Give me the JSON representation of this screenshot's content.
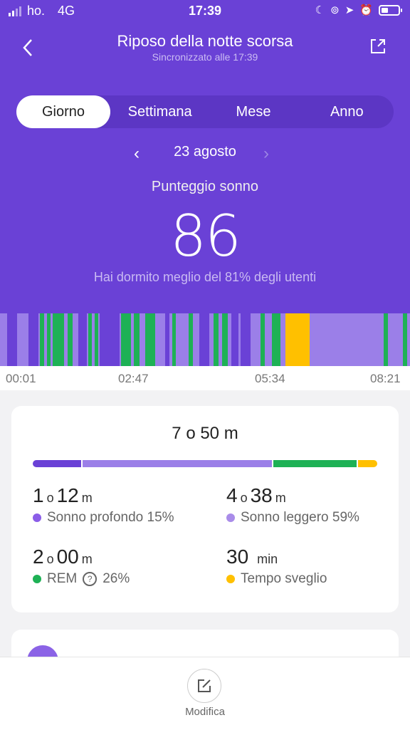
{
  "status_bar": {
    "carrier": "ho.",
    "network": "4G",
    "time": "17:39"
  },
  "header": {
    "title": "Riposo della notte scorsa",
    "subtitle": "Sincronizzato alle 17:39"
  },
  "tabs": [
    {
      "label": "Giorno",
      "active": true
    },
    {
      "label": "Settimana",
      "active": false
    },
    {
      "label": "Mese",
      "active": false
    },
    {
      "label": "Anno",
      "active": false
    }
  ],
  "date": "23 agosto",
  "score": {
    "label": "Punteggio sonno",
    "value": "86",
    "note": "Hai dormito meglio del 81% degli utenti"
  },
  "timeline": {
    "labels": [
      "00:01",
      "02:47",
      "05:34",
      "08:21"
    ],
    "colors": {
      "deep": "#6a41d6",
      "light": "#9b7fe8",
      "rem": "#1eb155",
      "awake": "#ffc000"
    }
  },
  "summary": {
    "total": "7 o 50 m",
    "distribution_pct": {
      "deep": 15,
      "light": 59,
      "rem": 26,
      "awake": 6
    },
    "stats": [
      {
        "num1": "1",
        "unit1": "o",
        "num2": "12",
        "unit2": "m",
        "label": "Sonno profondo 15%",
        "color": "#8b5de8"
      },
      {
        "num1": "4",
        "unit1": "o",
        "num2": "38",
        "unit2": "m",
        "label": "Sonno leggero 59%",
        "color": "#a98ce9"
      },
      {
        "num1": "2",
        "unit1": "o",
        "num2": "00",
        "unit2": "m",
        "label": "REM",
        "label_extra": "26%",
        "color": "#1eb155"
      },
      {
        "num1": "30",
        "unit1": "",
        "num2": "",
        "unit2": "min",
        "label": "Tempo sveglio",
        "color": "#ffc000"
      }
    ]
  },
  "bottom": {
    "edit_label": "Modifica"
  }
}
